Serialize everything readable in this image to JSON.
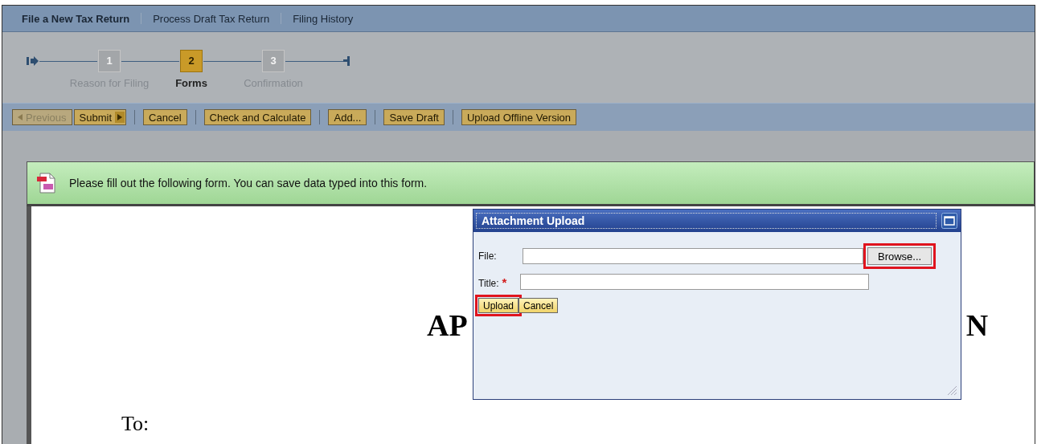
{
  "nav_tabs": [
    {
      "label": "File a New Tax Return",
      "selected": true
    },
    {
      "label": "Process Draft Tax Return",
      "selected": false
    },
    {
      "label": "Filing History",
      "selected": false
    }
  ],
  "steps": [
    {
      "number": "1",
      "label": "Reason for Filing",
      "selected": false
    },
    {
      "number": "2",
      "label": "Forms",
      "selected": true
    },
    {
      "number": "3",
      "label": "Confirmation",
      "selected": false
    }
  ],
  "toolbar": [
    [
      {
        "label": "Previous",
        "kind": "back",
        "disabled": true
      },
      {
        "label": "Submit",
        "kind": "next",
        "disabled": false
      }
    ],
    [
      {
        "label": "Cancel",
        "kind": "plain",
        "disabled": false
      }
    ],
    [
      {
        "label": "Check and Calculate",
        "kind": "plain",
        "disabled": false
      }
    ],
    [
      {
        "label": "Add...",
        "kind": "plain",
        "disabled": false
      }
    ],
    [
      {
        "label": "Save Draft",
        "kind": "plain",
        "disabled": false
      }
    ],
    [
      {
        "label": "Upload Offline Version",
        "kind": "plain",
        "disabled": false
      }
    ]
  ],
  "banner": {
    "message": "Please fill out the following form. You can save data typed into this form."
  },
  "document": {
    "heading_left": "AP",
    "heading_right": "N",
    "to_label": "To:"
  },
  "dialog": {
    "title": "Attachment Upload",
    "fields": [
      {
        "label": "File:",
        "required": false,
        "button": {
          "label": "Browse...",
          "highlighted": true
        }
      },
      {
        "label": "Title:",
        "required": true,
        "required_mark": "*"
      }
    ],
    "buttons": [
      {
        "label": "Upload",
        "highlighted": true
      },
      {
        "label": "Cancel",
        "highlighted": false
      }
    ]
  }
}
